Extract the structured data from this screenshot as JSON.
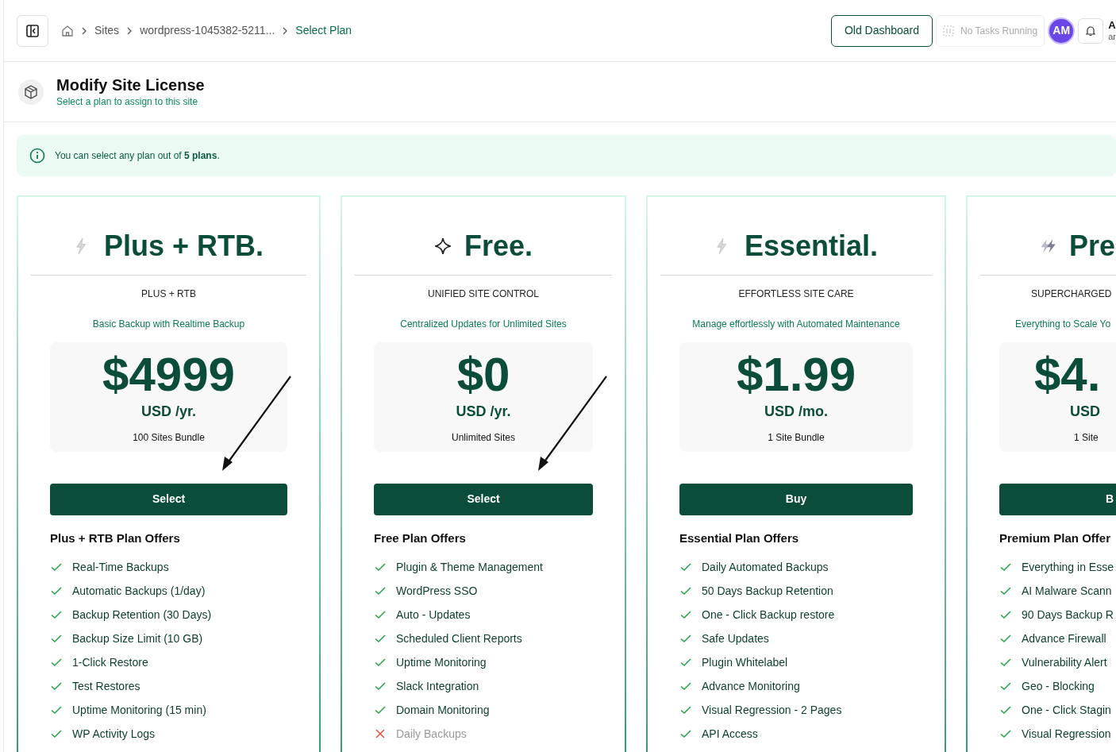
{
  "breadcrumb": [
    {
      "label": "Sites",
      "current": false
    },
    {
      "label": "wordpress-1045382-5211...",
      "current": false
    },
    {
      "label": "Select Plan",
      "current": true
    }
  ],
  "header": {
    "old_dashboard": "Old Dashboard",
    "tasks": "No Tasks Running",
    "avatar": "AM",
    "user_name": "A",
    "user_email": "ar"
  },
  "page": {
    "title": "Modify Site License",
    "subtitle": "Select a plan to assign to this site"
  },
  "alert": "You can select any plan out of **5 plans**.",
  "plans": [
    {
      "kind": "lightning",
      "name": "Plus + RTB.",
      "tagline": "PLUS + RTB",
      "description": "Basic Backup with Realtime Backup",
      "price": "$4999",
      "period": "USD /yr.",
      "sites": "100 Sites Bundle",
      "button": "Select",
      "arrow": true,
      "offers_title": "Plus + RTB Plan Offers",
      "features": [
        {
          "text": "Real-Time Backups",
          "included": true
        },
        {
          "text": "Automatic Backups (1/day)",
          "included": true
        },
        {
          "text": "Backup Retention (30 Days)",
          "included": true
        },
        {
          "text": "Backup Size Limit (10 GB)",
          "included": true
        },
        {
          "text": "1-Click Restore",
          "included": true
        },
        {
          "text": "Test Restores",
          "included": true
        },
        {
          "text": "Uptime Monitoring (15 min)",
          "included": true
        },
        {
          "text": "WP Activity Logs",
          "included": true
        }
      ]
    },
    {
      "kind": "sparkle",
      "name": "Free.",
      "tagline": "UNIFIED SITE CONTROL",
      "description": "Centralized Updates for Unlimited Sites",
      "price": "$0",
      "period": "USD /yr.",
      "sites": "Unlimited Sites",
      "button": "Select",
      "arrow": true,
      "offers_title": "Free Plan Offers",
      "features": [
        {
          "text": "Plugin & Theme Management",
          "included": true
        },
        {
          "text": "WordPress SSO",
          "included": true
        },
        {
          "text": "Auto - Updates",
          "included": true
        },
        {
          "text": "Scheduled Client Reports",
          "included": true
        },
        {
          "text": "Uptime Monitoring",
          "included": true
        },
        {
          "text": "Slack Integration",
          "included": true
        },
        {
          "text": "Domain Monitoring",
          "included": true
        },
        {
          "text": "Daily Backups",
          "included": false
        }
      ]
    },
    {
      "kind": "lightning",
      "name": "Essential.",
      "tagline": "EFFORTLESS SITE CARE",
      "description": "Manage effortlessly with Automated Maintenance",
      "price": "$1.99",
      "period": "USD /mo.",
      "sites": "1 Site Bundle",
      "button": "Buy",
      "arrow": false,
      "offers_title": "Essential Plan Offers",
      "features": [
        {
          "text": "Daily Automated Backups",
          "included": true
        },
        {
          "text": "50 Days Backup Retention",
          "included": true
        },
        {
          "text": "One - Click Backup restore",
          "included": true
        },
        {
          "text": "Safe Updates",
          "included": true
        },
        {
          "text": "Plugin Whitelabel",
          "included": true
        },
        {
          "text": "Advance Monitoring",
          "included": true
        },
        {
          "text": "Visual Regression - 2 Pages",
          "included": true
        },
        {
          "text": "API Access",
          "included": true
        }
      ]
    },
    {
      "kind": "double-lightning",
      "name": "Pre",
      "tagline": "SUPERCHARGED",
      "description": "Everything to Scale Yo",
      "price": "$4.",
      "period": "USD",
      "sites": "1 Site",
      "button": "B",
      "arrow": false,
      "offers_title": "Premium Plan Offer",
      "features": [
        {
          "text": "Everything in Esse",
          "included": true
        },
        {
          "text": "AI Malware Scann",
          "included": true
        },
        {
          "text": "90 Days Backup R",
          "included": true
        },
        {
          "text": "Advance Firewall",
          "included": true
        },
        {
          "text": "Vulnerability Alert",
          "included": true
        },
        {
          "text": "Geo - Blocking",
          "included": true
        },
        {
          "text": "One - Click Stagin",
          "included": true
        },
        {
          "text": "Visual Regression",
          "included": true
        }
      ]
    }
  ]
}
